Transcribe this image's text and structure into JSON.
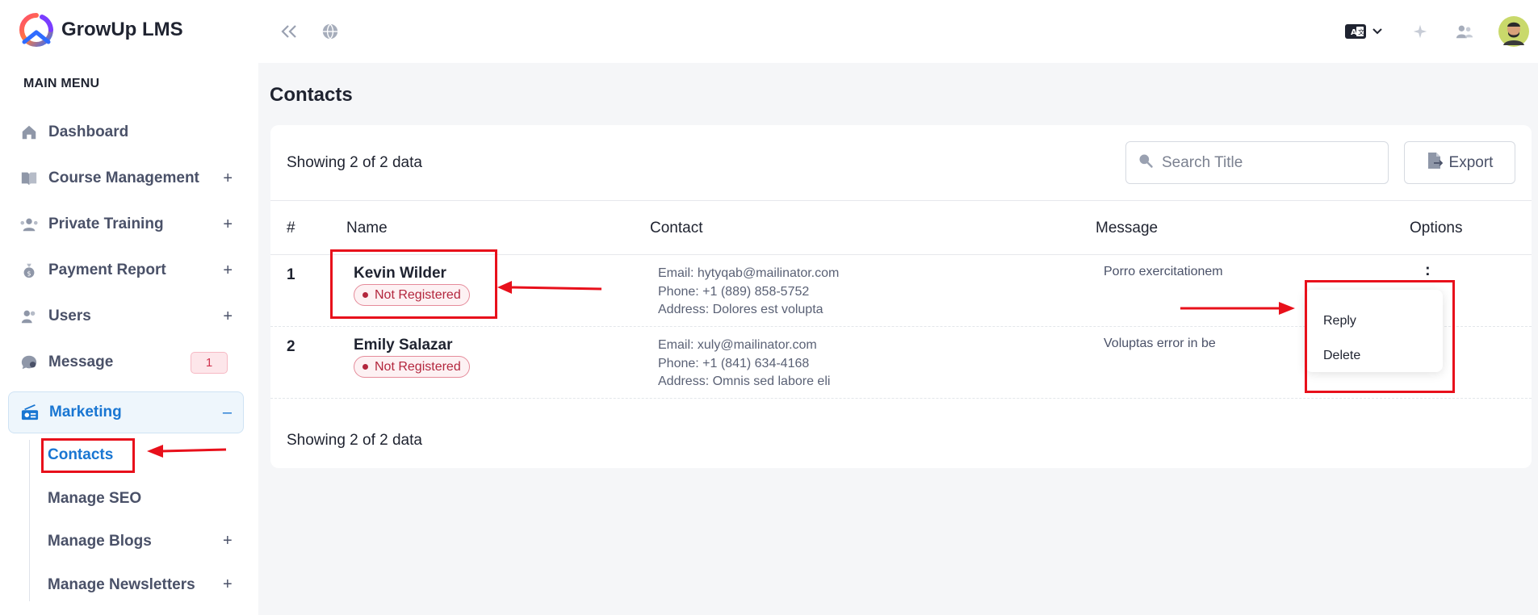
{
  "brand": {
    "name": "GrowUp LMS"
  },
  "sidebar": {
    "menu_title": "MAIN MENU",
    "items": [
      {
        "label": "Dashboard",
        "icon": "home-icon",
        "has_plus": false
      },
      {
        "label": "Course Management",
        "icon": "book-icon",
        "has_plus": true
      },
      {
        "label": "Private Training",
        "icon": "users-group-icon",
        "has_plus": true
      },
      {
        "label": "Payment Report",
        "icon": "money-bag-icon",
        "has_plus": true
      },
      {
        "label": "Users",
        "icon": "users-icon",
        "has_plus": true
      },
      {
        "label": "Message",
        "icon": "chat-icon",
        "badge": "1"
      },
      {
        "label": "Marketing",
        "icon": "radio-icon",
        "active": true,
        "toggle": "–"
      }
    ],
    "sub_items": [
      {
        "label": "Contacts",
        "active": true
      },
      {
        "label": "Manage SEO"
      },
      {
        "label": "Manage Blogs",
        "has_plus": true
      },
      {
        "label": "Manage Newsletters",
        "has_plus": true
      }
    ],
    "plus_symbol": "+"
  },
  "topbar": {
    "icons": [
      "collapse-icon",
      "globe-icon",
      "language-icon",
      "chevron-down-icon",
      "sparkle-icon",
      "user-switch-icon",
      "avatar"
    ]
  },
  "page": {
    "title": "Contacts",
    "showing_text": "Showing 2 of 2 data",
    "search_placeholder": "Search Title",
    "export_label": "Export"
  },
  "table": {
    "headers": [
      "#",
      "Name",
      "Contact",
      "Message",
      "Options"
    ],
    "rows": [
      {
        "num": "1",
        "name": "Kevin Wilder",
        "status": "Not Registered",
        "email": "Email: hytyqab@mailinator.com",
        "phone": "Phone: +1 (889) 858-5752",
        "address": "Address: Dolores est volupta",
        "message": "Porro exercitationem",
        "options": ":"
      },
      {
        "num": "2",
        "name": "Emily Salazar",
        "status": "Not Registered",
        "email": "Email: xuly@mailinator.com",
        "phone": "Phone: +1 (841) 634-4168",
        "address": "Address: Omnis sed labore eli",
        "message": "Voluptas error in be",
        "options": ""
      }
    ]
  },
  "dropdown": {
    "items": [
      "Reply",
      "Delete"
    ]
  },
  "colors": {
    "accent": "#1976d2",
    "annotation": "#e8101b",
    "badge_red": "#b3263d"
  }
}
